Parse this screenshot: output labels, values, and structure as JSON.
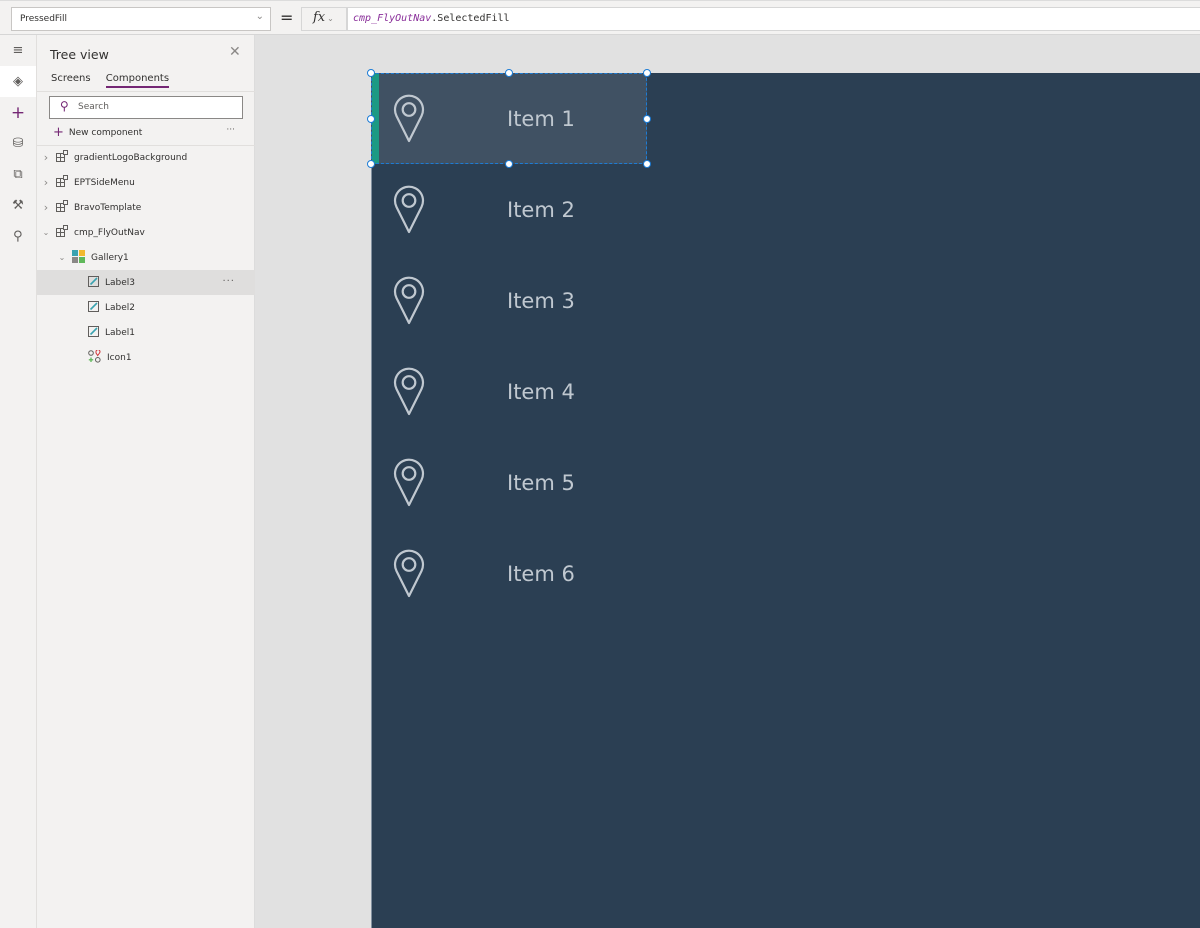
{
  "formula_bar": {
    "property": "PressedFill",
    "equals": "=",
    "fx_label": "fx",
    "formula_identifier": "cmp_FlyOutNav",
    "formula_rest": ".SelectedFill"
  },
  "rail": {
    "items": [
      {
        "icon": "hamburger-menu-icon",
        "glyph": "≡"
      },
      {
        "icon": "layers-icon",
        "glyph": "◈",
        "active": true
      },
      {
        "icon": "insert-plus-icon",
        "glyph": "+"
      },
      {
        "icon": "database-icon",
        "glyph": "⛁"
      },
      {
        "icon": "media-icon",
        "glyph": "⧉"
      },
      {
        "icon": "tools-icon",
        "glyph": "⚒"
      },
      {
        "icon": "search-icon",
        "glyph": "⚲"
      }
    ]
  },
  "tree_view": {
    "title": "Tree view",
    "close_glyph": "✕",
    "tabs": [
      {
        "label": "Screens",
        "active": false
      },
      {
        "label": "Components",
        "active": true
      }
    ],
    "search_placeholder": "Search",
    "new_component_label": "New component",
    "more_glyph": "···",
    "items": [
      {
        "label": "gradientLogoBackground",
        "type": "component",
        "expanded": false,
        "indent": 0
      },
      {
        "label": "EPTSideMenu",
        "type": "component",
        "expanded": false,
        "indent": 0
      },
      {
        "label": "BravoTemplate",
        "type": "component",
        "expanded": false,
        "indent": 0
      },
      {
        "label": "cmp_FlyOutNav",
        "type": "component",
        "expanded": true,
        "indent": 0
      },
      {
        "label": "Gallery1",
        "type": "gallery",
        "expanded": true,
        "indent": 1
      },
      {
        "label": "Label3",
        "type": "label",
        "indent": 2,
        "selected": true
      },
      {
        "label": "Label2",
        "type": "label",
        "indent": 2
      },
      {
        "label": "Label1",
        "type": "label",
        "indent": 2
      },
      {
        "label": "Icon1",
        "type": "icon",
        "indent": 2
      }
    ]
  },
  "canvas": {
    "colors": {
      "screen_bg": "#2b3f53",
      "selected_item_bg": "#405163",
      "accent_bar": "#1c9a84",
      "selection_border": "#1c7cd6",
      "item_text": "#c0c8d0"
    },
    "nav_items": [
      {
        "label": "Item 1",
        "icon": "location-pin-icon",
        "selected": true
      },
      {
        "label": "Item 2",
        "icon": "location-pin-icon"
      },
      {
        "label": "Item 3",
        "icon": "location-pin-icon"
      },
      {
        "label": "Item 4",
        "icon": "location-pin-icon"
      },
      {
        "label": "Item 5",
        "icon": "location-pin-icon"
      },
      {
        "label": "Item 6",
        "icon": "location-pin-icon"
      }
    ]
  }
}
